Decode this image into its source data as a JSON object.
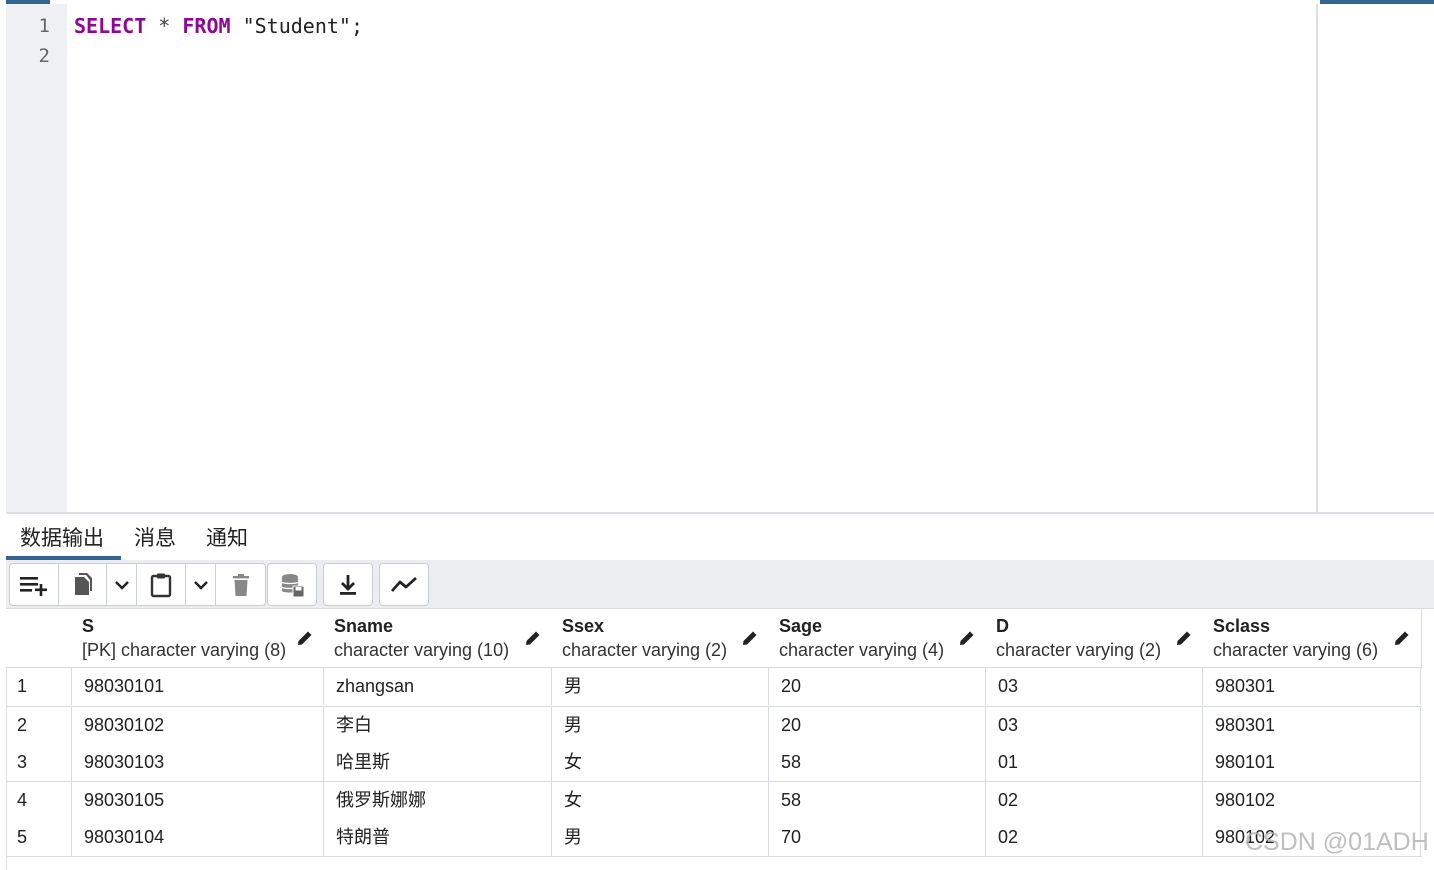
{
  "editor": {
    "line_numbers": [
      "1",
      "2"
    ],
    "code": {
      "kw1": "SELECT",
      "op": " * ",
      "kw2": "FROM",
      "str": " \"Student\";"
    }
  },
  "output_tabs": [
    {
      "label": "数据输出",
      "active": true
    },
    {
      "label": "消息",
      "active": false
    },
    {
      "label": "通知",
      "active": false
    }
  ],
  "toolbar": {
    "buttons": [
      "add-row-icon",
      "copy-icon",
      "copy-options-chevron-icon",
      "paste-icon",
      "paste-options-chevron-icon",
      "delete-icon",
      "save-data-icon",
      "download-icon",
      "graph-icon"
    ]
  },
  "grid": {
    "columns": [
      {
        "name": "S",
        "type": "[PK] character varying (8)"
      },
      {
        "name": "Sname",
        "type": "character varying (10)"
      },
      {
        "name": "Ssex",
        "type": "character varying (2)"
      },
      {
        "name": "Sage",
        "type": "character varying (4)"
      },
      {
        "name": "D",
        "type": "character varying (2)"
      },
      {
        "name": "Sclass",
        "type": "character varying (6)"
      }
    ],
    "rows": [
      {
        "n": "1",
        "cells": [
          "98030101",
          "zhangsan",
          "男",
          "20",
          "03",
          "980301"
        ]
      },
      {
        "n": "2",
        "cells": [
          "98030102",
          "李白",
          "男",
          "20",
          "03",
          "980301"
        ]
      },
      {
        "n": "3",
        "cells": [
          "98030103",
          "哈里斯",
          "女",
          "58",
          "01",
          "980101"
        ]
      },
      {
        "n": "4",
        "cells": [
          "98030105",
          "俄罗斯娜娜",
          "女",
          "58",
          "02",
          "980102"
        ]
      },
      {
        "n": "5",
        "cells": [
          "98030104",
          "特朗普",
          "男",
          "70",
          "02",
          "980102"
        ]
      }
    ]
  },
  "watermark": "CSDN @01ADH",
  "colors": {
    "accent": "#326690",
    "keyword": "#8b0a91"
  }
}
